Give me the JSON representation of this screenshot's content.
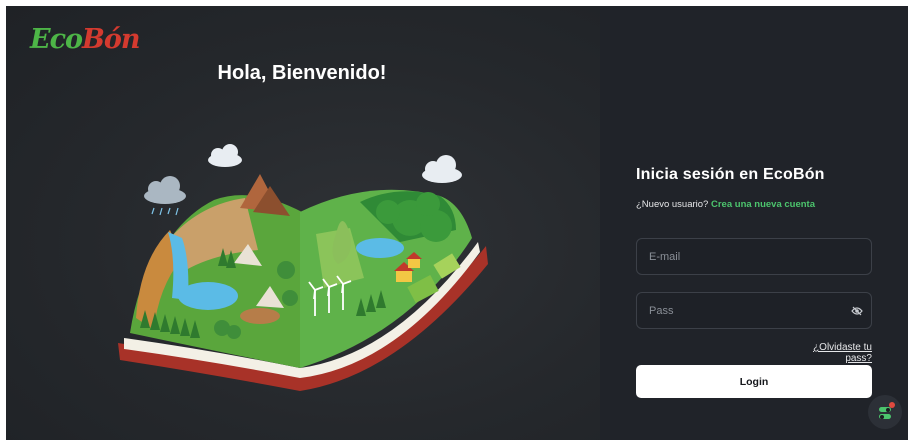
{
  "brand": {
    "logo_main": "Eco",
    "logo_accent": "Bón"
  },
  "hero": {
    "welcome": "Hola, Bienvenido!"
  },
  "login": {
    "title": "Inicia sesión en EcoBón",
    "new_user_prompt": "¿Nuevo usuario?",
    "create_account_link": "Crea una nueva cuenta",
    "email_placeholder": "E-mail",
    "password_placeholder": "Pass",
    "forgot_link": "¿Olvidaste tu pass?",
    "submit_label": "Login"
  },
  "icons": {
    "password_toggle": "eye-slash-icon",
    "floating_action": "settings-toggle-icon"
  },
  "colors": {
    "left_background": "#25282c",
    "right_background": "#202329",
    "accent_green": "#4cc46d",
    "logo_red": "#d43a2f",
    "button_background": "#ffffff"
  }
}
